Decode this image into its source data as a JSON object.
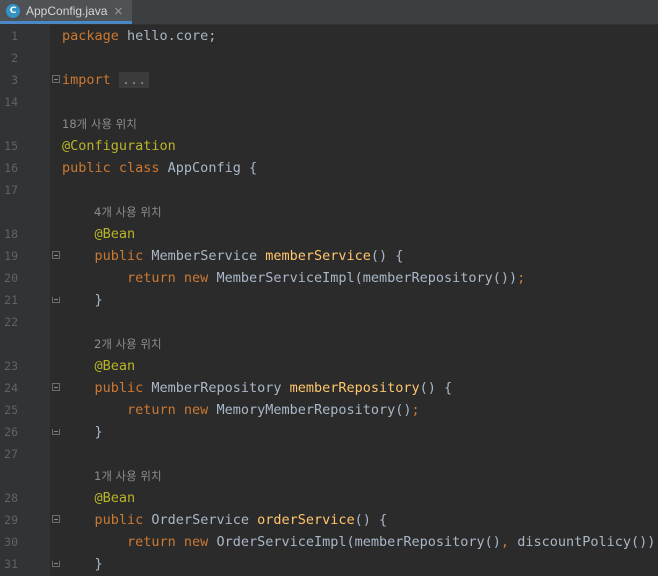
{
  "tab": {
    "icon": "C",
    "label": "AppConfig.java",
    "close": "×"
  },
  "lines": [
    {
      "n": "1",
      "parts": [
        [
          "kw",
          "package"
        ],
        [
          "p",
          " hello.core;"
        ]
      ]
    },
    {
      "n": "2",
      "parts": []
    },
    {
      "n": "3",
      "parts": [
        [
          "kw",
          "import"
        ],
        [
          "p",
          " "
        ],
        [
          "cm",
          "..."
        ]
      ]
    },
    {
      "n": "14",
      "parts": []
    },
    {
      "n": "",
      "hint": "18개 사용 위치",
      "indent": 0
    },
    {
      "n": "15",
      "parts": [
        [
          "an",
          "@Configuration"
        ]
      ]
    },
    {
      "n": "16",
      "parts": [
        [
          "kw",
          "public class"
        ],
        [
          "p",
          " AppConfig {"
        ]
      ]
    },
    {
      "n": "17",
      "parts": []
    },
    {
      "n": "",
      "hint": "4개 사용 위치",
      "indent": 1
    },
    {
      "n": "18",
      "parts": [
        [
          "p",
          "    "
        ],
        [
          "an",
          "@Bean"
        ]
      ]
    },
    {
      "n": "19",
      "parts": [
        [
          "p",
          "    "
        ],
        [
          "kw",
          "public"
        ],
        [
          "p",
          " MemberService "
        ],
        [
          "fn",
          "memberService"
        ],
        [
          "p",
          "() {"
        ]
      ]
    },
    {
      "n": "20",
      "parts": [
        [
          "p",
          "        "
        ],
        [
          "kw",
          "return new"
        ],
        [
          "p",
          " MemberServiceImpl(memberRepository())"
        ],
        [
          "kw",
          ";"
        ]
      ]
    },
    {
      "n": "21",
      "parts": [
        [
          "p",
          "    }"
        ]
      ]
    },
    {
      "n": "22",
      "parts": []
    },
    {
      "n": "",
      "hint": "2개 사용 위치",
      "indent": 1
    },
    {
      "n": "23",
      "parts": [
        [
          "p",
          "    "
        ],
        [
          "an",
          "@Bean"
        ]
      ]
    },
    {
      "n": "24",
      "parts": [
        [
          "p",
          "    "
        ],
        [
          "kw",
          "public"
        ],
        [
          "p",
          " MemberRepository "
        ],
        [
          "fn",
          "memberRepository"
        ],
        [
          "p",
          "() {"
        ]
      ]
    },
    {
      "n": "25",
      "parts": [
        [
          "p",
          "        "
        ],
        [
          "kw",
          "return new"
        ],
        [
          "p",
          " MemoryMemberRepository()"
        ],
        [
          "kw",
          ";"
        ]
      ]
    },
    {
      "n": "26",
      "parts": [
        [
          "p",
          "    }"
        ]
      ]
    },
    {
      "n": "27",
      "parts": []
    },
    {
      "n": "",
      "hint": "1개 사용 위치",
      "indent": 1
    },
    {
      "n": "28",
      "parts": [
        [
          "p",
          "    "
        ],
        [
          "an",
          "@Bean"
        ]
      ]
    },
    {
      "n": "29",
      "parts": [
        [
          "p",
          "    "
        ],
        [
          "kw",
          "public"
        ],
        [
          "p",
          " OrderService "
        ],
        [
          "fn",
          "orderService"
        ],
        [
          "p",
          "() {"
        ]
      ]
    },
    {
      "n": "30",
      "parts": [
        [
          "p",
          "        "
        ],
        [
          "kw",
          "return new"
        ],
        [
          "p",
          " OrderServiceImpl(memberRepository()"
        ],
        [
          "kw",
          ","
        ],
        [
          "p",
          " discountPolicy())"
        ],
        [
          "kw",
          ";"
        ]
      ]
    },
    {
      "n": "31",
      "parts": [
        [
          "p",
          "    }"
        ]
      ]
    }
  ],
  "colors": {
    "keyword": "#cc7832",
    "annotation": "#bbb529",
    "method": "#ffc66d",
    "text": "#a9b7c6",
    "background": "#2b2b2b"
  }
}
